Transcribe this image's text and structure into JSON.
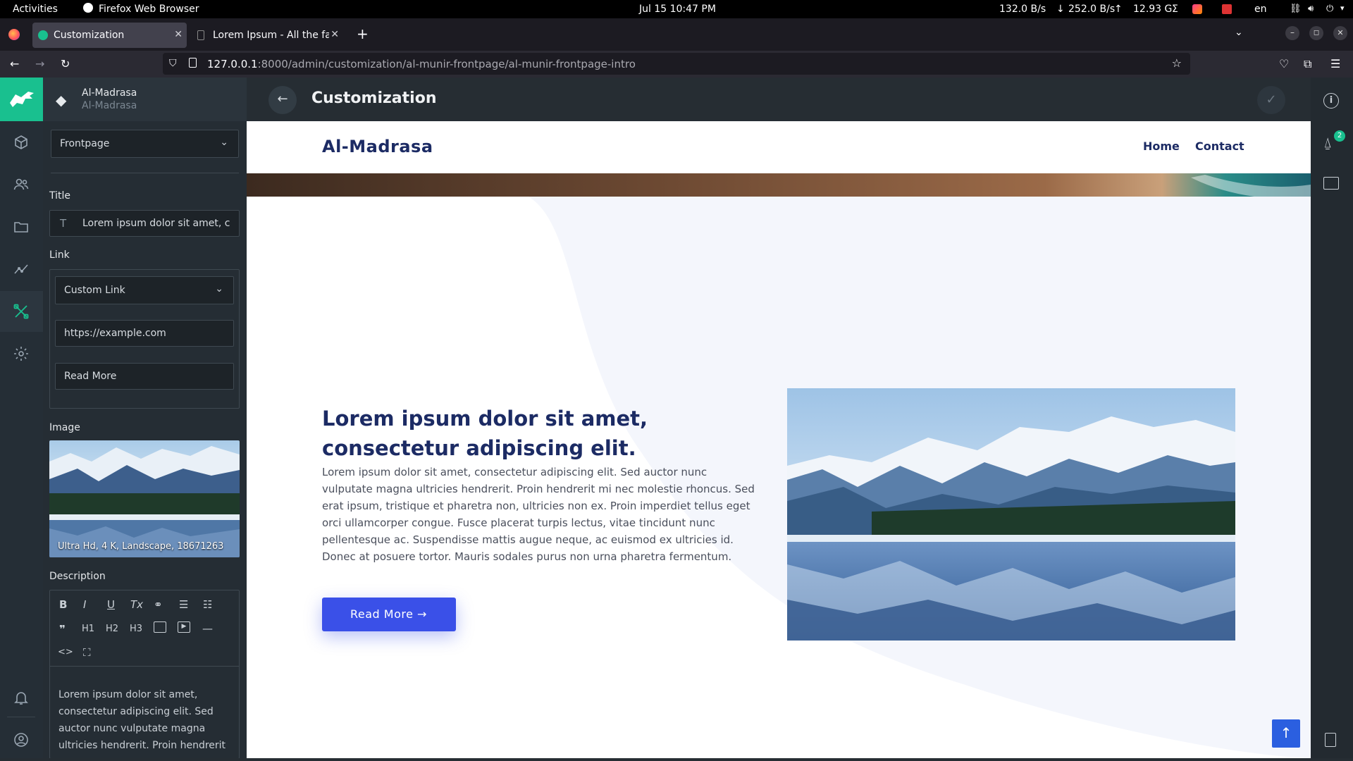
{
  "os": {
    "activities": "Activities",
    "app_name": "Firefox Web Browser",
    "clock": "Jul 15  10:47 PM",
    "net_down": "132.0 B/s",
    "net_up": "252.0 B/s",
    "mem": "12.93 G",
    "lang": "en"
  },
  "browser": {
    "tabs": [
      {
        "label": "Customization",
        "active": true
      },
      {
        "label": "Lorem Ipsum - All the fac",
        "active": false
      }
    ],
    "url_host": "127.0.0.1",
    "url_path": ":8000/admin/customization/al-munir-frontpage/al-munir-frontpage-intro"
  },
  "admin": {
    "site_name": "Al-Madrasa",
    "site_sub": "Al-Madrasa",
    "page_title": "Customization",
    "notification_count": "2",
    "section_select": "Frontpage",
    "title_label": "Title",
    "title_value": "Lorem ipsum dolor sit amet, cons",
    "link_label": "Link",
    "link_type": "Custom Link",
    "link_url": "https://example.com",
    "link_text": "Read More",
    "image_label": "Image",
    "image_caption": "Ultra Hd, 4 K, Landscape, 18671263",
    "description_label": "Description",
    "editor_toolbar": [
      "B",
      "I",
      "U",
      "Tx",
      "link",
      "ul",
      "ol",
      "”",
      "H1",
      "H2",
      "H3",
      "img",
      "video",
      "hr",
      "code",
      "fullscreen"
    ],
    "description_text": "Lorem ipsum dolor sit amet, consectetur adipiscing elit. Sed auctor nunc vulputate magna ultricies hendrerit. Proin hendrerit"
  },
  "preview": {
    "brand": "Al-Madrasa",
    "nav": [
      "Home",
      "Contact"
    ],
    "heading": "Lorem ipsum dolor sit amet, consectetur adipiscing elit.",
    "body": "Lorem ipsum dolor sit amet, consectetur adipiscing elit. Sed auctor nunc vulputate magna ultricies hendrerit. Proin hendrerit mi nec molestie rhoncus. Sed erat ipsum, tristique et pharetra non, ultricies non ex. Proin imperdiet tellus eget orci ullamcorper congue. Fusce placerat turpis lectus, vitae tincidunt nunc pellentesque ac. Suspendisse mattis augue neque, ac euismod ex ultricies id. Donec at posuere tortor. Mauris sodales purus non urna pharetra fermentum.",
    "button": "Read More →"
  },
  "colors": {
    "accent_green": "#19c08f",
    "brand_navy": "#1c2b64",
    "button_blue": "#3a50e8"
  }
}
